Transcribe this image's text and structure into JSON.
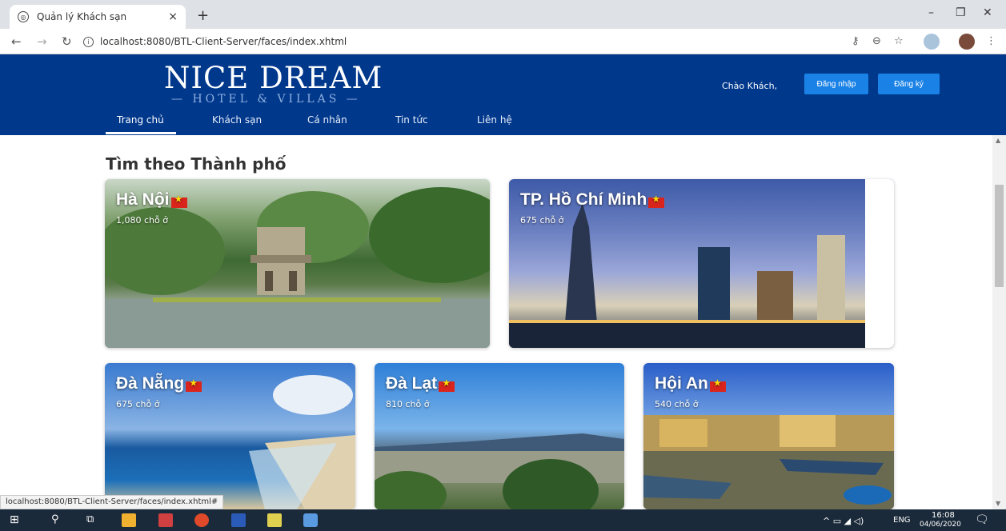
{
  "browser": {
    "tab_title": "Quản lý Khách sạn",
    "tab_close": "×",
    "new_tab": "+",
    "url": "localhost:8080/BTL-Client-Server/faces/index.xhtml",
    "window_controls": [
      "–",
      "❐",
      "✕"
    ],
    "status_url": "localhost:8080/BTL-Client-Server/faces/index.xhtml#"
  },
  "header": {
    "logo_main": "NICE DREAM",
    "logo_sub": "— HOTEL & VILLAS —",
    "greeting": "Chào Khách,",
    "login_label": "Đăng nhập",
    "register_label": "Đăng ký",
    "nav": [
      "Trang chủ",
      "Khách sạn",
      "Cá nhân",
      "Tin tức",
      "Liên hệ"
    ]
  },
  "main": {
    "section_title": "Tìm theo Thành phố",
    "cities": [
      {
        "name": "Hà Nội",
        "count": "1,080 chỗ ở"
      },
      {
        "name": "TP. Hồ Chí Minh",
        "count": "675 chỗ ở"
      },
      {
        "name": "Đà Nẵng",
        "count": "675 chỗ ở"
      },
      {
        "name": "Đà Lạt",
        "count": "810 chỗ ở"
      },
      {
        "name": "Hội An",
        "count": "540 chỗ ở"
      }
    ]
  },
  "taskbar": {
    "lang": "ENG",
    "time": "16:08",
    "date": "04/06/2020"
  },
  "colors": {
    "header_bg": "#00388c",
    "button_bg": "#1a82e6"
  }
}
